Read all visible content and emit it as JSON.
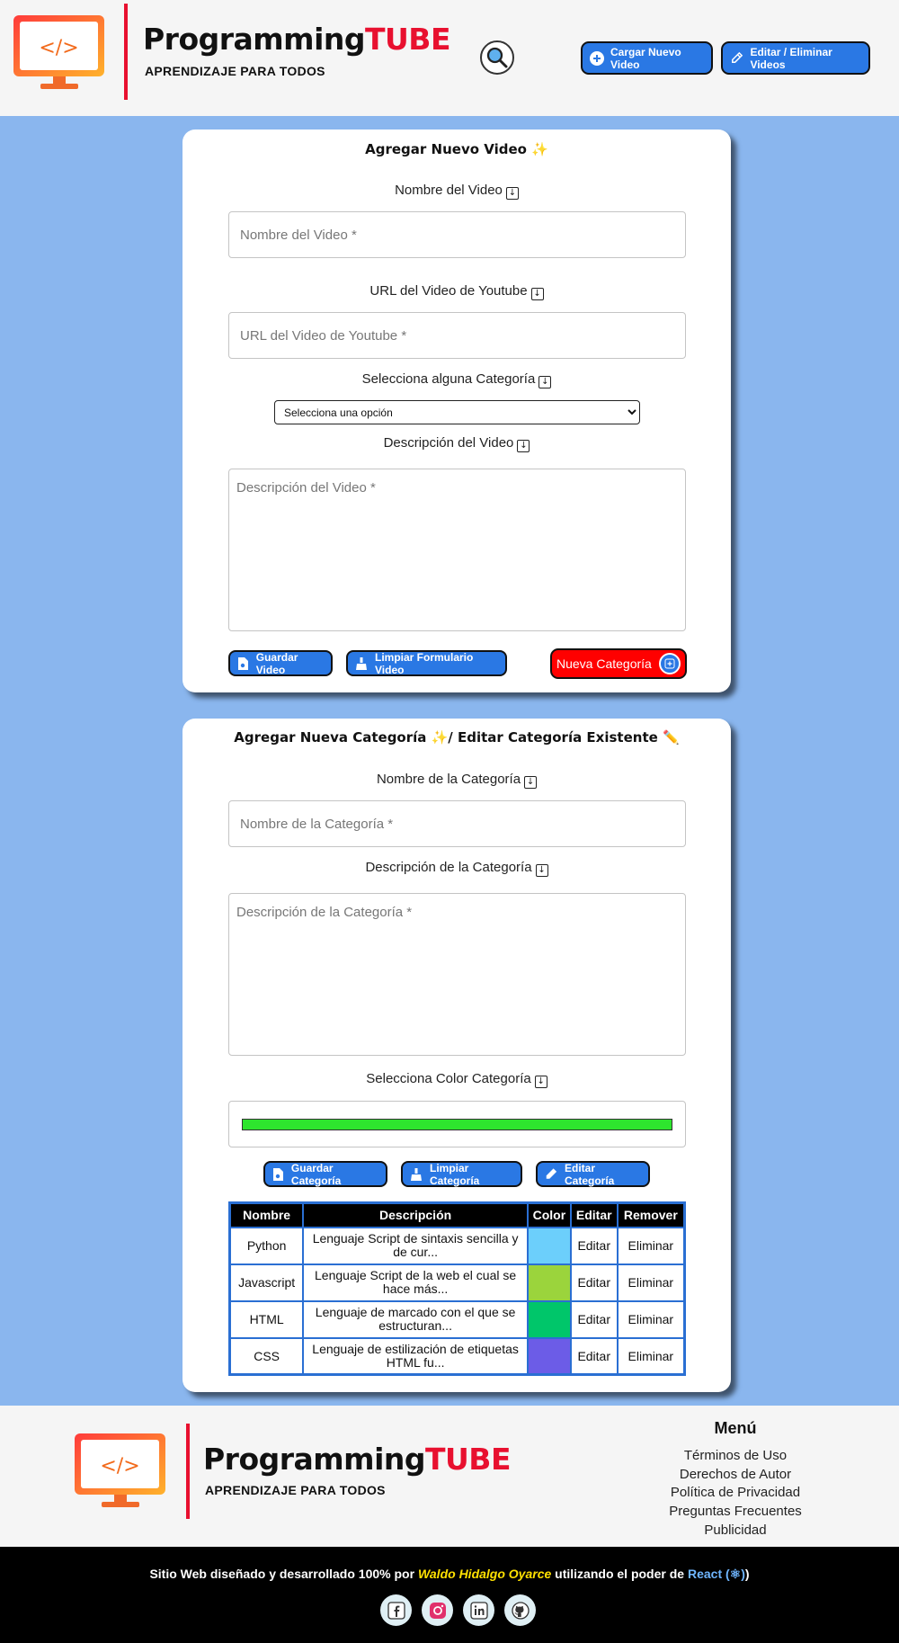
{
  "header": {
    "brand_part1": "Programming",
    "brand_part2": "TUBE",
    "tagline": "APRENDIZAJE PARA TODOS",
    "upload_label": "Cargar Nuevo Video",
    "edit_label": "Editar / Eliminar Videos"
  },
  "video_form": {
    "title": "Agregar Nuevo Video ✨",
    "name_label": "Nombre del Video",
    "name_placeholder": "Nombre del Video *",
    "url_label": "URL del Video de Youtube",
    "url_placeholder": "URL del Video de Youtube *",
    "category_label": "Selecciona alguna Categoría",
    "category_selected": "Selecciona una opción",
    "description_label": "Descripción del Video",
    "description_placeholder": "Descripción del Video *",
    "save_label": "Guardar Video",
    "clear_label": "Limpiar Formulario Video",
    "new_category_label": "Nueva Categoría"
  },
  "category_form": {
    "title": "Agregar Nueva Categoría ✨/ Editar Categoría Existente ✏️",
    "name_label": "Nombre de la Categoría",
    "name_placeholder": "Nombre de la Categoría *",
    "description_label": "Descripción de la Categoría",
    "description_placeholder": "Descripción de la Categoría *",
    "color_label": "Selecciona Color Categoría",
    "color_value": "#2ee52e",
    "save_label": "Guardar Categoría",
    "clear_label": "Limpiar Categoría",
    "edit_label": "Editar Categoría"
  },
  "table": {
    "headers": [
      "Nombre",
      "Descripción",
      "Color",
      "Editar",
      "Remover"
    ],
    "rows": [
      {
        "name": "Python",
        "description": "Lenguaje Script de sintaxis sencilla y de cur...",
        "color": "#6ccffb",
        "edit": "Editar",
        "remove": "Eliminar"
      },
      {
        "name": "Javascript",
        "description": "Lenguaje Script de la web el cual se hace más...",
        "color": "#9bd43c",
        "edit": "Editar",
        "remove": "Eliminar"
      },
      {
        "name": "HTML",
        "description": "Lenguaje de marcado con el que se estructuran...",
        "color": "#00c66a",
        "edit": "Editar",
        "remove": "Eliminar"
      },
      {
        "name": "CSS",
        "description": "Lenguaje de estilización de etiquetas HTML fu...",
        "color": "#6c5ce7",
        "edit": "Editar",
        "remove": "Eliminar"
      }
    ]
  },
  "footer": {
    "brand_part1": "Programming",
    "brand_part2": "TUBE",
    "tagline": "APRENDIZAJE PARA TODOS",
    "menu_title": "Menú",
    "menu_items": [
      "Términos de Uso",
      "Derechos de Autor",
      "Política de Privacidad",
      "Preguntas Frecuentes",
      "Publicidad"
    ],
    "credits_pre": "Sitio Web diseñado y desarrollado 100% por ",
    "credits_author": "Waldo Hidalgo Oyarce",
    "credits_mid": " utilizando el poder de ",
    "credits_react": "React (⚛)",
    "credits_post": ")",
    "socials": [
      "facebook-icon",
      "instagram-icon",
      "linkedin-icon",
      "github-icon"
    ]
  },
  "colors": {
    "brand_red": "#e8102f",
    "button_blue": "#2a78e4",
    "page_background": "#8ab6ee",
    "new_category_red": "#ff0000"
  }
}
